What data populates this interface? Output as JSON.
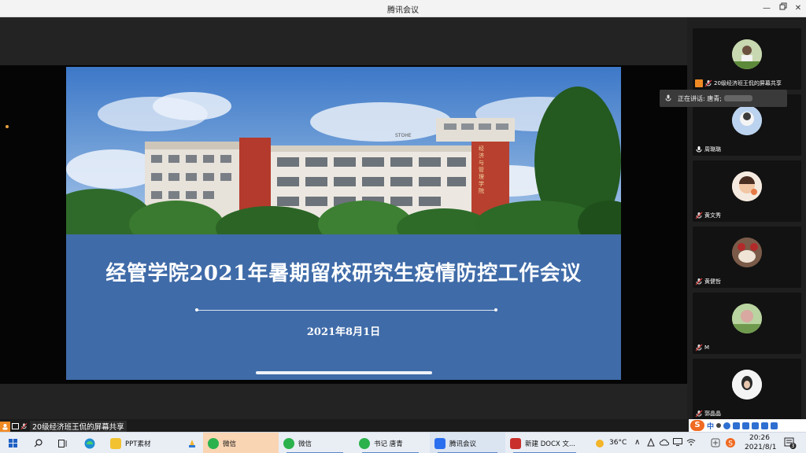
{
  "window": {
    "title": "腾讯会议"
  },
  "slide": {
    "title": "经管学院2021年暑期留校研究生疫情防控工作会议",
    "date": "2021年8月1日",
    "building_sign": "经济与管理学院",
    "building_top": "STOHE"
  },
  "speaking": {
    "label": "正在讲话: 唐青;"
  },
  "participants": [
    {
      "name": "20级经济班王侃的屏幕共享",
      "sharing": true
    },
    {
      "name": "周璐璐"
    },
    {
      "name": "黄文秀"
    },
    {
      "name": "黄健哲"
    },
    {
      "name": "M"
    },
    {
      "name": "郭晶晶"
    }
  ],
  "share_bar": {
    "label": "20级经济班王侃的屏幕共享"
  },
  "ime": {
    "mode": "中"
  },
  "taskbar": {
    "apps": [
      {
        "label": "PPT素材",
        "color": "#f2c230"
      },
      {
        "label": "微信",
        "color": "#2bb24c",
        "active": true
      },
      {
        "label": "微信",
        "color": "#2bb24c"
      },
      {
        "label": "书记 唐青",
        "color": "#2bb24c"
      },
      {
        "label": "腾讯会议",
        "color": "#2a6ef0"
      },
      {
        "label": "新建 DOCX 文...",
        "color": "#c9302c"
      }
    ],
    "weather": "36°C",
    "time": "20:26",
    "date": "2021/8/1",
    "notification_count": "3"
  },
  "colors": {
    "accent": "#f08a24",
    "slide_bg": "#3f6ba8"
  }
}
